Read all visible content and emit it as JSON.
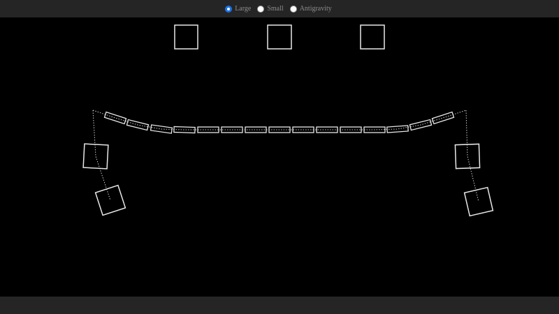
{
  "mode_selector": {
    "options": [
      {
        "label": "Large",
        "checked": true
      },
      {
        "label": "Small",
        "checked": false
      },
      {
        "label": "Antigravity",
        "checked": false
      }
    ]
  },
  "colors": {
    "toolbar_bg": "#252525",
    "canvas_bg": "#000000",
    "outline": "#e8e8e8",
    "radio_accent": "#1a73e8",
    "label_text": "#8c8c8c"
  }
}
